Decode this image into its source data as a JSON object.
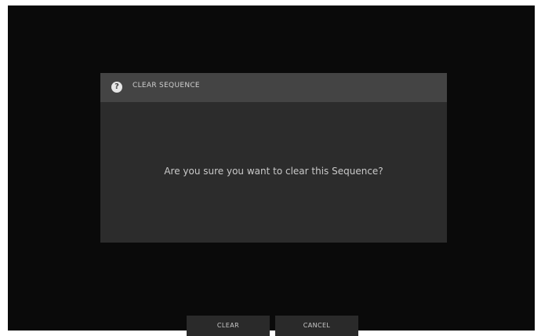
{
  "dialog": {
    "icon": "question-icon",
    "icon_glyph": "?",
    "title": "CLEAR SEQUENCE",
    "message": "Are you sure you want to clear this Sequence?"
  },
  "footer": {
    "clear_label": "CLEAR",
    "cancel_label": "CANCEL"
  },
  "colors": {
    "background": "#0a0a0a",
    "dialog_body": "#2c2c2c",
    "dialog_header": "#444444",
    "button": "#2a2a2a",
    "text": "#c9c9c9"
  }
}
